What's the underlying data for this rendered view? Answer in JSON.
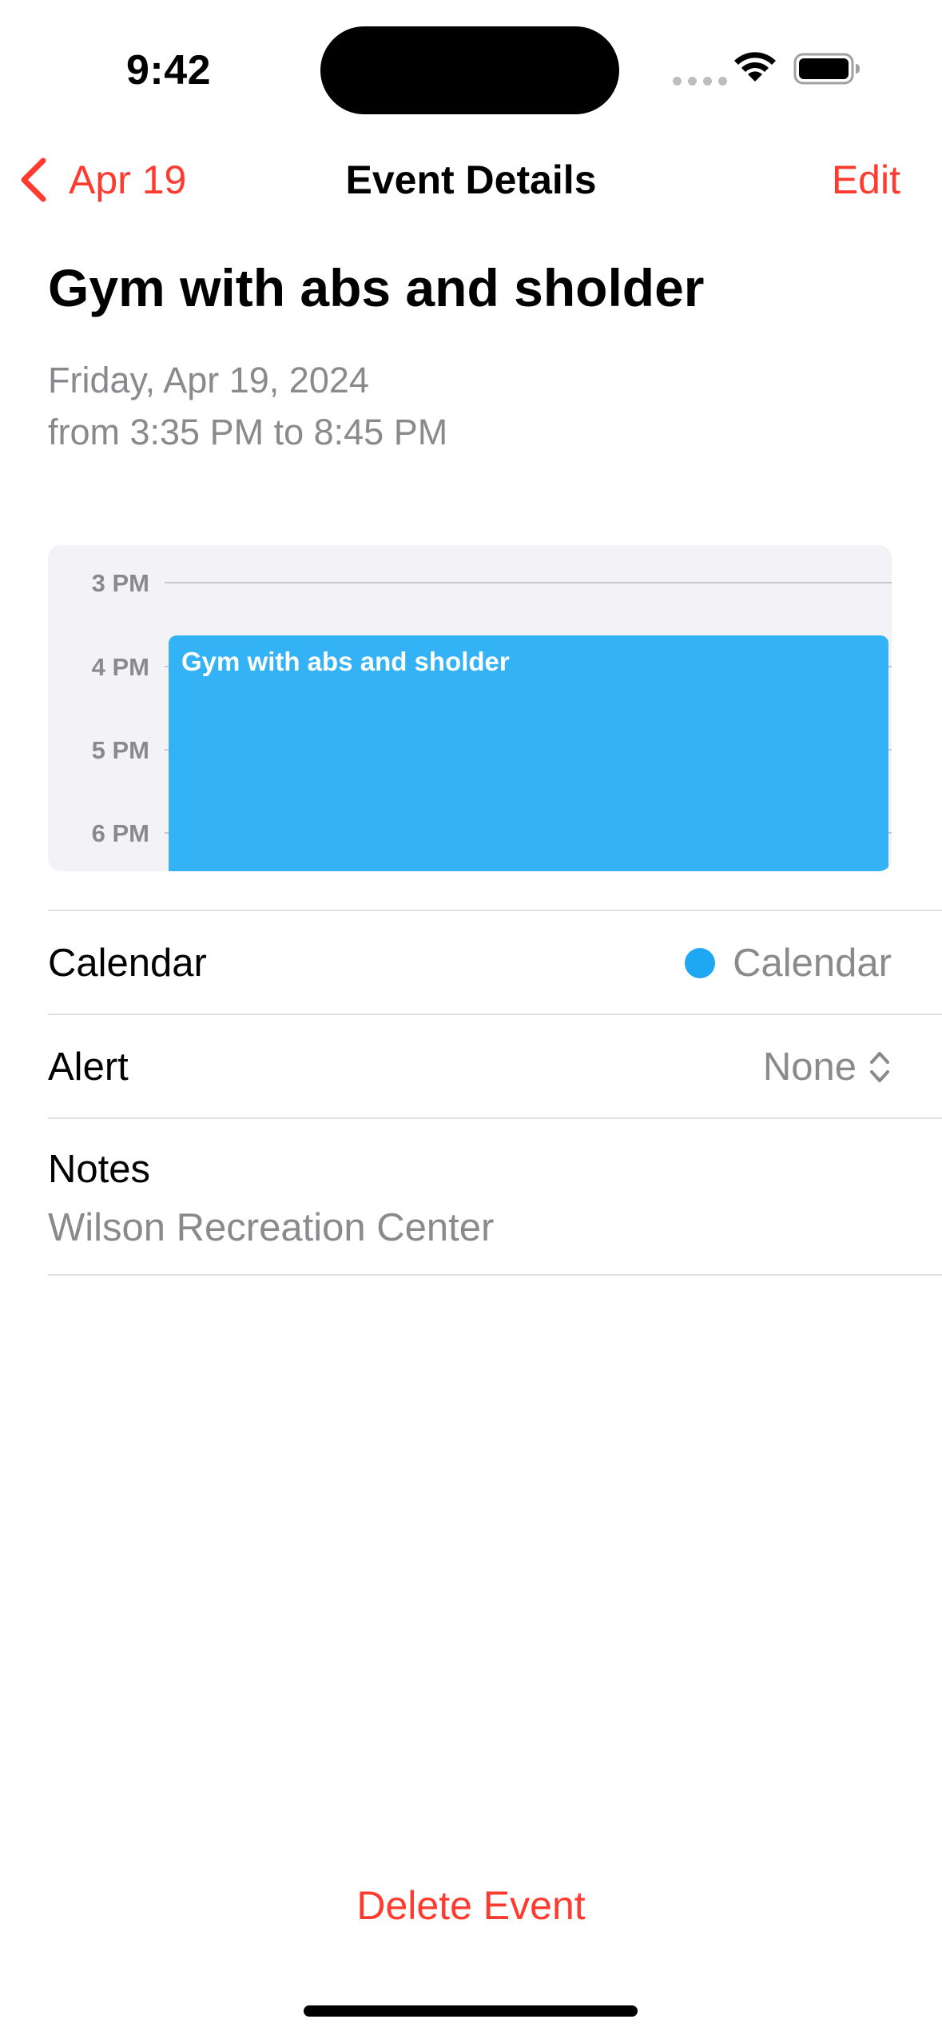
{
  "status_bar": {
    "time": "9:42"
  },
  "nav": {
    "back_label": "Apr 19",
    "title": "Event Details",
    "edit_label": "Edit"
  },
  "event": {
    "title": "Gym with abs and sholder",
    "date": "Friday, Apr 19, 2024",
    "time_range": "from 3:35 PM to 8:45 PM"
  },
  "timeline": {
    "hours": [
      "3 PM",
      "4 PM",
      "5 PM",
      "6 PM"
    ],
    "block_title": "Gym with abs and sholder",
    "block_color": "#33b3f5"
  },
  "rows": {
    "calendar": {
      "label": "Calendar",
      "value": "Calendar",
      "dot_color": "#1ea7f2"
    },
    "alert": {
      "label": "Alert",
      "value": "None"
    },
    "notes": {
      "label": "Notes",
      "value": "Wilson Recreation Center"
    }
  },
  "actions": {
    "delete_label": "Delete Event"
  },
  "colors": {
    "accent": "#ff3b30",
    "secondary_text": "#8a8a8e",
    "background": "#ffffff"
  }
}
